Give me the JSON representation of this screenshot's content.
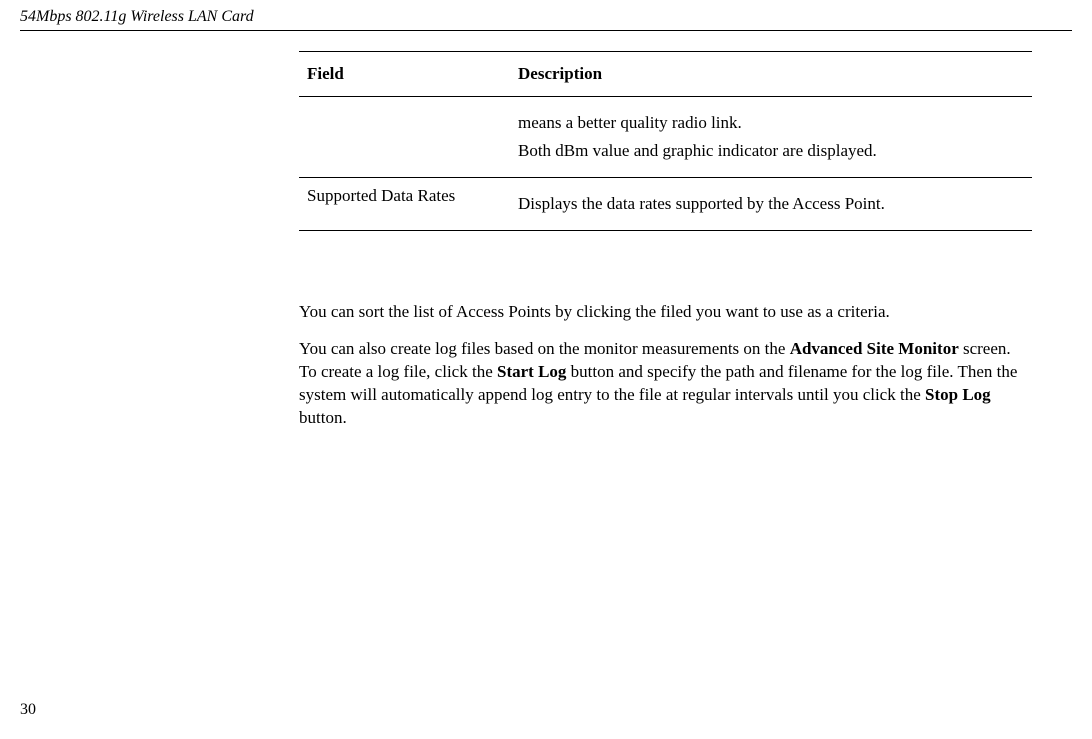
{
  "header": {
    "title": "54Mbps 802.11g Wireless LAN Card"
  },
  "table": {
    "field_header": "Field",
    "description_header": "Description",
    "rows": [
      {
        "field": "",
        "description_line1": "means a better quality radio link.",
        "description_line2": "Both dBm value and graphic indicator are displayed."
      },
      {
        "field": "Supported Data Rates",
        "description_line1": "Displays the data rates supported by the Access Point.",
        "description_line2": ""
      }
    ]
  },
  "paragraphs": {
    "p1": "You can sort the list of Access Points by clicking the filed you want to use as a criteria.",
    "p2_part1": "You can also create log files based on the monitor measurements on the ",
    "p2_bold1": "Advanced Site Monitor",
    "p2_part2": " screen. To create a log file, click the ",
    "p2_bold2": "Start Log",
    "p2_part3": " button and specify the path and filename for the log file. Then the system will automatically append log entry to the file at regular intervals until you click the ",
    "p2_bold3": "Stop Log",
    "p2_part4": " button."
  },
  "page_number": "30"
}
